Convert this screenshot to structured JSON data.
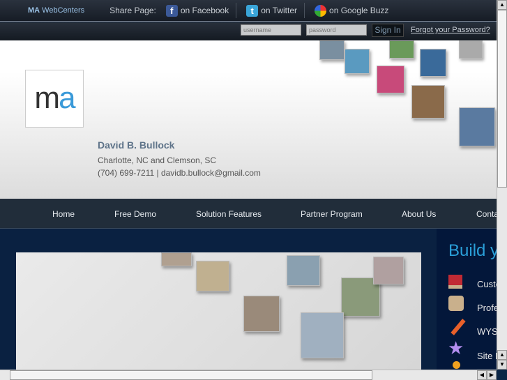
{
  "topbar": {
    "brand_ma": "MA",
    "brand_rest": " WebCenters",
    "share_label": "Share Page:",
    "facebook": "on Facebook",
    "twitter": "on Twitter",
    "google_buzz": "on Google Buzz"
  },
  "login": {
    "username_placeholder": "username",
    "password_placeholder": "password",
    "sign_in": "Sign In",
    "forgot": "Forgot your Password?"
  },
  "header": {
    "logo_m": "m",
    "logo_a": "a",
    "name": "David B. Bullock",
    "location": "Charlotte, NC and Clemson, SC",
    "contact": "(704) 699-7211 | davidb.bullock@gmail.com"
  },
  "nav": {
    "items": [
      "Home",
      "Free Demo",
      "Solution Features",
      "Partner Program",
      "About Us",
      "Contact"
    ]
  },
  "side": {
    "title": "Build your",
    "features": [
      "Custom",
      "Professional",
      "WYSIWYG",
      "Site F"
    ]
  },
  "colors": {
    "accent": "#2a9fd8",
    "nav_bg": "#212d3a",
    "main_bg": "#0a2141"
  }
}
